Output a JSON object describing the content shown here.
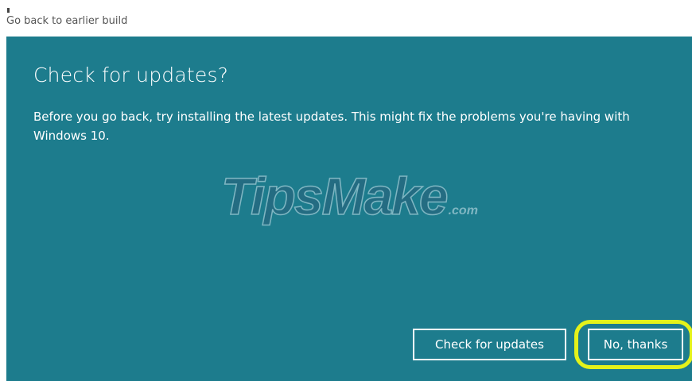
{
  "window": {
    "title": "Go back to earlier build"
  },
  "dialog": {
    "heading": "Check for updates?",
    "body": "Before you go back, try installing the latest updates. This might fix the problems you're having with Windows 10."
  },
  "buttons": {
    "check_label": "Check for updates",
    "no_label": "No, thanks"
  },
  "watermark": {
    "main": "TipsMake",
    "suffix": ".com"
  },
  "colors": {
    "panel_background": "#1d7c8d",
    "text": "#ffffff",
    "highlight": "#e4f21a"
  }
}
